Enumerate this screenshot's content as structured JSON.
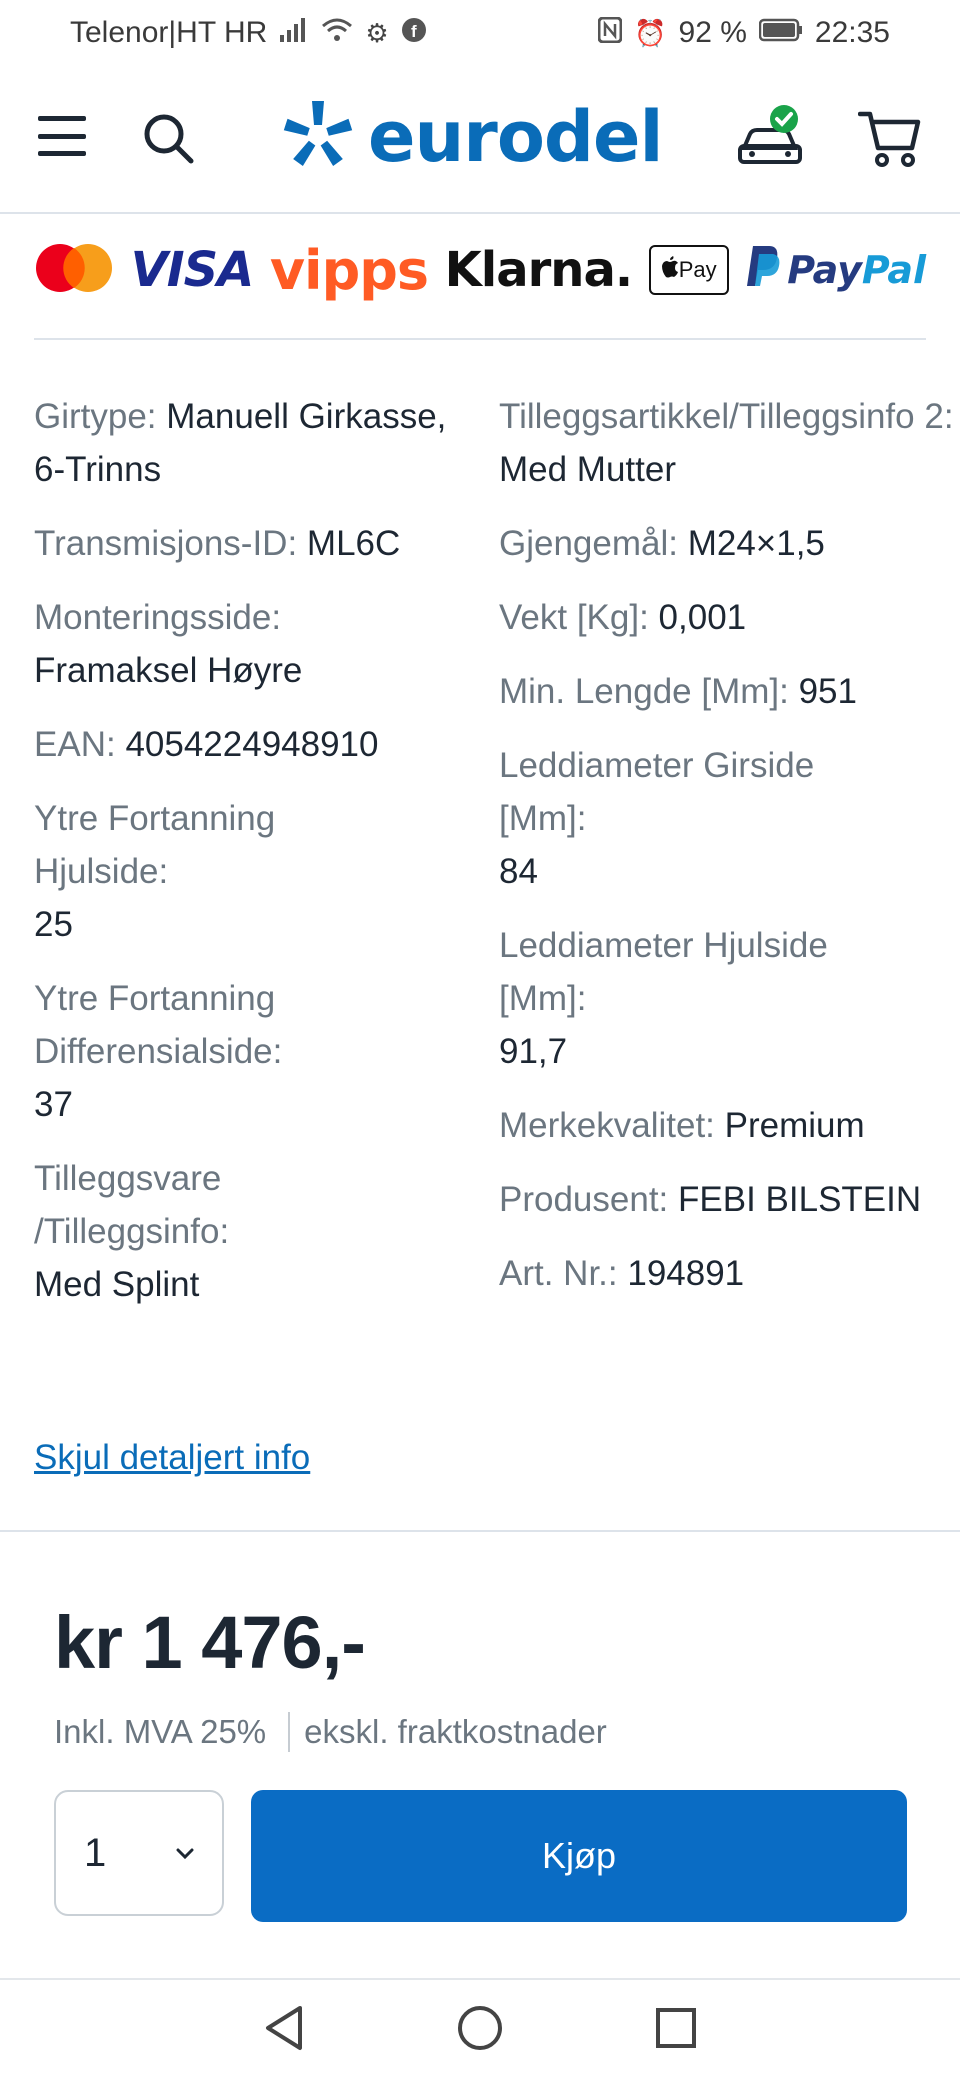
{
  "status_bar": {
    "carrier": "Telenor|HT HR",
    "battery": "92 %",
    "time": "22:35"
  },
  "header": {
    "logo_text": "eurodel",
    "brand_color": "#0a6cb8"
  },
  "payments": {
    "visa": "VISA",
    "vipps": "vipps",
    "klarna": "Klarna.",
    "apple_pay": "Pay",
    "paypal_1": "Pay",
    "paypal_2": "Pal"
  },
  "specs": {
    "left": [
      {
        "label": "Girtype:",
        "value": "Manuell Girkasse, 6-Trinns"
      },
      {
        "label": "Transmisjons-ID:",
        "value": "ML6C"
      },
      {
        "label": "Monteringsside:",
        "value": "Framaksel Høyre"
      },
      {
        "label": "EAN:",
        "value": "4054224948910"
      },
      {
        "label": "Ytre Fortanning Hjulside:",
        "value": "25"
      },
      {
        "label": "Ytre Fortanning Differensialside:",
        "value": "37"
      },
      {
        "label": "Tilleggsvare /Tilleggsinfo:",
        "value": "Med Splint"
      }
    ],
    "right": [
      {
        "label": "Tilleggsartikkel/Tilleggsinfo 2:",
        "value": "Med Mutter"
      },
      {
        "label": "Gjengemål:",
        "value": "M24×1,5"
      },
      {
        "label": "Vekt [Kg]:",
        "value": "0,001"
      },
      {
        "label": "Min. Lengde [Mm]:",
        "value": "951"
      },
      {
        "label": "Leddiameter Girside [Mm]:",
        "value": "84"
      },
      {
        "label": "Leddiameter Hjulside [Mm]:",
        "value": "91,7"
      },
      {
        "label": "Merkekvalitet:",
        "value": "Premium"
      },
      {
        "label": "Produsent:",
        "value": "FEBI BILSTEIN"
      },
      {
        "label": "Art. Nr.:",
        "value": "194891"
      }
    ]
  },
  "toggle_link": "Skjul detaljert info",
  "price": {
    "amount": "kr 1 476,-",
    "vat": "Inkl. MVA 25%",
    "shipping": "ekskl. fraktkostnader"
  },
  "purchase": {
    "quantity": "1",
    "buy_label": "Kjøp",
    "button_color": "#0a6cc4"
  }
}
